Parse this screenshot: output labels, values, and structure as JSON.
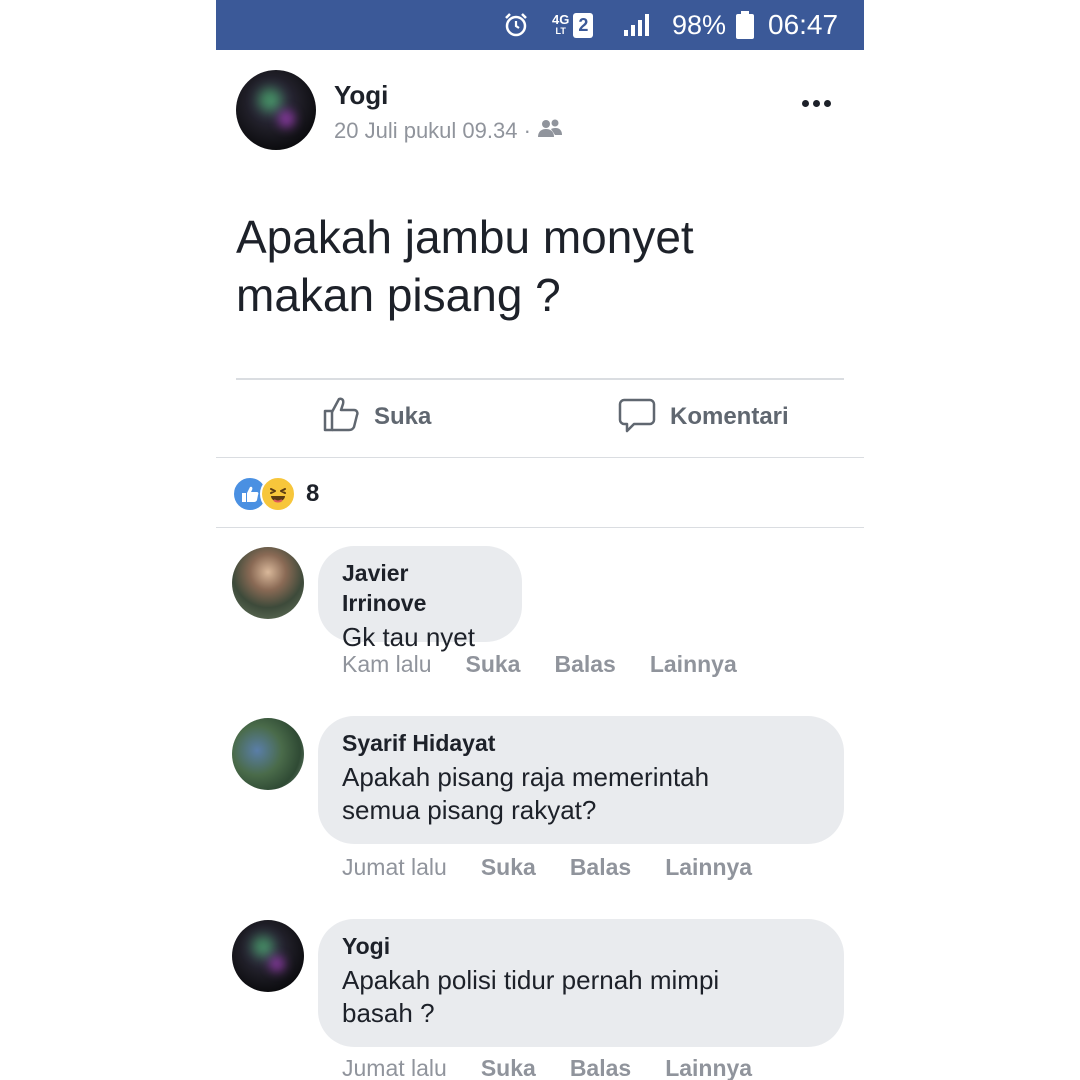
{
  "status_bar": {
    "network_label": "4G",
    "network_sub": "LT",
    "sim": "2",
    "battery": "98%",
    "time": "06:47",
    "icons": [
      "alarm-icon",
      "signal-icon",
      "battery-icon"
    ]
  },
  "post": {
    "author": "Yogi",
    "timestamp": "20 Juli pukul 09.34 ·",
    "text_line1": "Apakah jambu monyet",
    "text_line2": "makan pisang ?",
    "actions": {
      "like": "Suka",
      "comment": "Komentari"
    },
    "reaction_count": "8"
  },
  "comments": [
    {
      "author": "Javier Irrinove",
      "text": "Gk tau nyet",
      "time": "Kam lalu",
      "like": "Suka",
      "reply": "Balas",
      "more": "Lainnya"
    },
    {
      "author": "Syarif Hidayat",
      "text_line1": "Apakah pisang raja memerintah",
      "text_line2": "semua pisang rakyat?",
      "time": "Jumat lalu",
      "like": "Suka",
      "reply": "Balas",
      "more": "Lainnya"
    },
    {
      "author": "Yogi",
      "text_line1": "Apakah polisi tidur pernah mimpi",
      "text_line2": "basah ?",
      "time": "Jumat lalu",
      "like": "Suka",
      "reply": "Balas",
      "more": "Lainnya"
    }
  ],
  "colors": {
    "status_bar": "#3b5998",
    "bubble": "#e9ebee",
    "muted_text": "#90949c",
    "like_reaction": "#4a90e2"
  }
}
